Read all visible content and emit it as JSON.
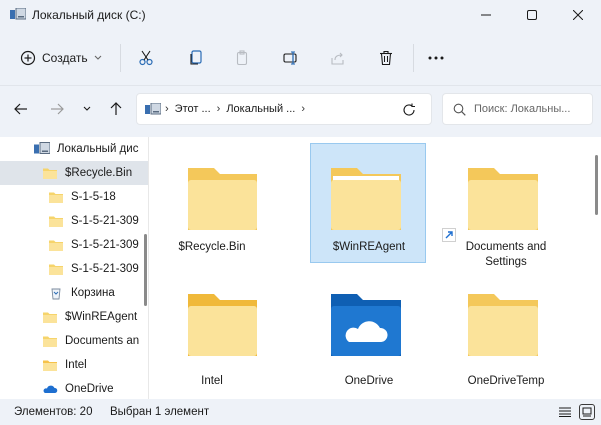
{
  "window": {
    "title": "Локальный диск (C:)"
  },
  "toolbar": {
    "create_label": "Создать"
  },
  "address": {
    "crumbs": [
      "Этот ...",
      "Локальный ..."
    ]
  },
  "search": {
    "placeholder": "Поиск: Локальны..."
  },
  "sidebar": {
    "items": [
      {
        "label": "Локальный дис",
        "icon": "drive-icon"
      },
      {
        "label": "$Recycle.Bin",
        "icon": "folder-icon",
        "selected": true
      },
      {
        "label": "S-1-5-18",
        "icon": "folder-icon"
      },
      {
        "label": "S-1-5-21-309",
        "icon": "folder-icon"
      },
      {
        "label": "S-1-5-21-309",
        "icon": "folder-icon"
      },
      {
        "label": "S-1-5-21-309",
        "icon": "folder-icon"
      },
      {
        "label": "Корзина",
        "icon": "recycle-bin-icon"
      },
      {
        "label": "$WinREAgent",
        "icon": "folder-icon"
      },
      {
        "label": "Documents an",
        "icon": "folder-icon"
      },
      {
        "label": "Intel",
        "icon": "folder-icon"
      },
      {
        "label": "OneDrive",
        "icon": "onedrive-icon"
      }
    ]
  },
  "content": {
    "items": [
      {
        "label": "$Recycle.Bin",
        "icon": "folder-icon"
      },
      {
        "label": "$WinREAgent",
        "icon": "folder-icon",
        "selected": true
      },
      {
        "label": "Documents and Settings",
        "icon": "shortcut-folder-icon"
      },
      {
        "label": "Intel",
        "icon": "folder-icon"
      },
      {
        "label": "OneDrive",
        "icon": "onedrive-folder-icon"
      },
      {
        "label": "OneDriveTemp",
        "icon": "folder-icon"
      }
    ]
  },
  "status": {
    "item_count": "Элементов: 20",
    "selection": "Выбран 1 элемент"
  },
  "colors": {
    "folder": "#f6d46b",
    "folder_light": "#fbe39a",
    "onedrive_folder": "#1f78d1",
    "selection": "#cde5f9"
  }
}
